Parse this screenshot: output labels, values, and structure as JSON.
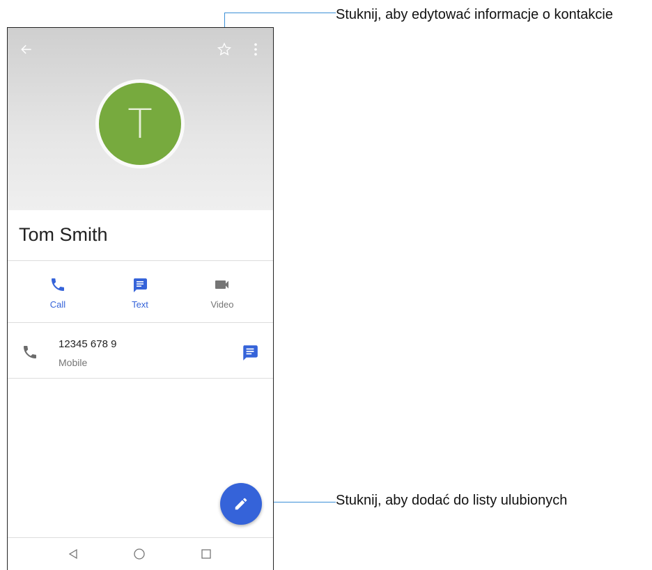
{
  "annotations": {
    "top": "Stuknij, aby edytować informacje o kontakcie",
    "bottom": "Stuknij, aby dodać do listy ulubionych"
  },
  "contact": {
    "initial": "T",
    "name": "Tom Smith",
    "avatar_color": "#77aa3e"
  },
  "actions": [
    {
      "label": "Call",
      "icon": "phone-icon",
      "color": "#3563d9"
    },
    {
      "label": "Text",
      "icon": "message-icon",
      "color": "#3563d9"
    },
    {
      "label": "Video",
      "icon": "videocam-icon",
      "color": "#757575"
    }
  ],
  "phone_entry": {
    "number": "12345 678 9",
    "type": "Mobile"
  },
  "icons": {
    "back": "arrow-back-icon",
    "favorite": "star-outline-icon",
    "more": "more-vert-icon",
    "fab": "edit-pencil-icon"
  },
  "colors": {
    "accent": "#3563d9",
    "leader_line": "#3a8fd6"
  }
}
